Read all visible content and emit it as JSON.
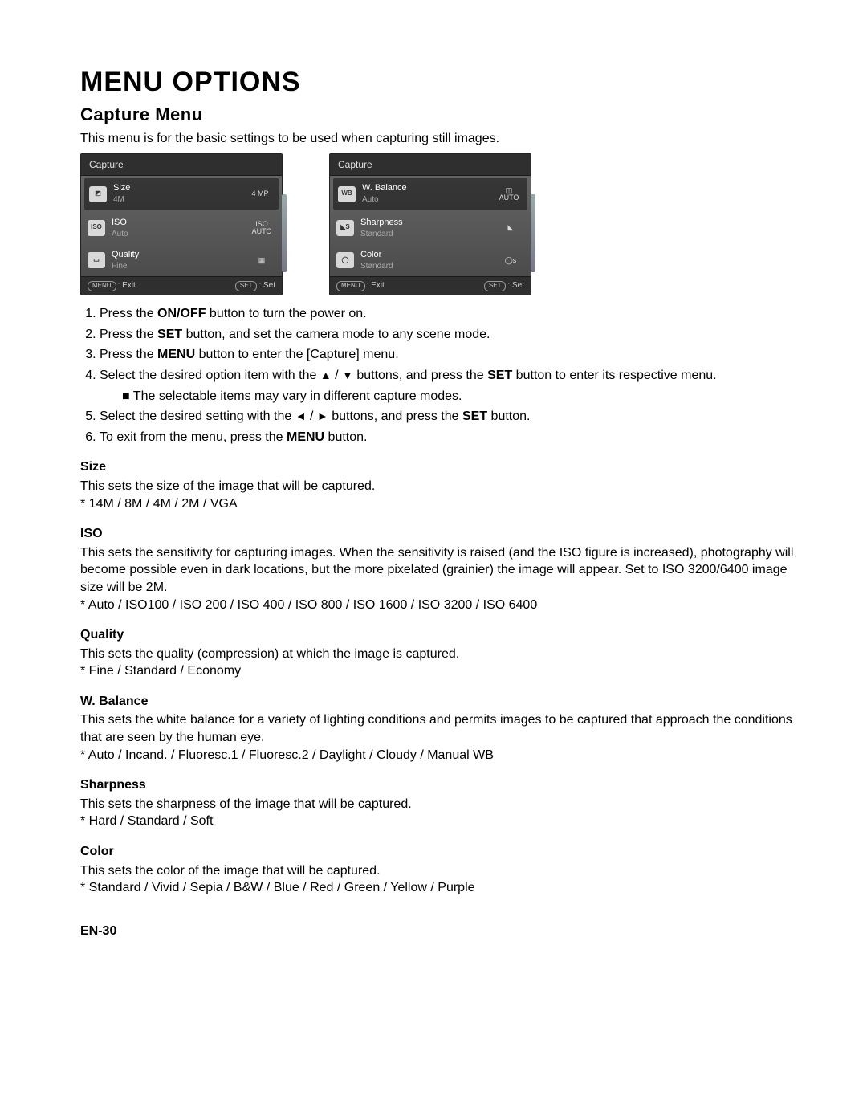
{
  "title": "MENU OPTIONS",
  "subtitle": "Capture Menu",
  "intro": "This menu is for the basic settings to be used when capturing still images.",
  "screens": {
    "left": {
      "header": "Capture",
      "rows": [
        {
          "icon": "◩",
          "name": "Size",
          "value": "4M",
          "right": "4\nMP",
          "highlight": true
        },
        {
          "icon": "ISO",
          "name": "ISO",
          "value": "Auto",
          "right": "ISO\nAUTO",
          "highlight": false
        },
        {
          "icon": "▭",
          "name": "Quality",
          "value": "Fine",
          "right": "▦",
          "highlight": false
        }
      ],
      "footer": {
        "menu_btn": "MENU",
        "menu_lbl": ": Exit",
        "set_btn": "SET",
        "set_lbl": ": Set"
      }
    },
    "right": {
      "header": "Capture",
      "rows": [
        {
          "icon": "WB",
          "name": "W. Balance",
          "value": "Auto",
          "right": "◫\nAUTO",
          "highlight": true
        },
        {
          "icon": "◣S",
          "name": "Sharpness",
          "value": "Standard",
          "right": "◣",
          "highlight": false
        },
        {
          "icon": "◯",
          "name": "Color",
          "value": "Standard",
          "right": "◯s",
          "highlight": false
        }
      ],
      "footer": {
        "menu_btn": "MENU",
        "menu_lbl": ": Exit",
        "set_btn": "SET",
        "set_lbl": ": Set"
      }
    }
  },
  "steps": {
    "s1a": "Press the ",
    "s1b": "ON/OFF",
    "s1c": " button to turn the power on.",
    "s2a": "Press the ",
    "s2b": "SET",
    "s2c": " button, and set the camera mode to any scene mode.",
    "s3a": "Press the ",
    "s3b": "MENU",
    "s3c": " button to enter the [Capture] menu.",
    "s4a": "Select the desired option item with the ",
    "s4b": "▲",
    "s4c": " / ",
    "s4d": "▼",
    "s4e": " buttons, and press the ",
    "s4f": "SET",
    "s4g": " button to enter its respective menu.",
    "s4_sub": "The selectable items may vary in different capture modes.",
    "s5a": "Select the desired setting with the ",
    "s5b": "◄",
    "s5c": " / ",
    "s5d": "►",
    "s5e": " buttons, and press the ",
    "s5f": "SET",
    "s5g": " button.",
    "s6a": "To exit from the menu, press the ",
    "s6b": "MENU",
    "s6c": " button."
  },
  "sections": [
    {
      "heading": "Size",
      "desc": "This sets the size of the image that will be captured.",
      "opts": "* 14M / 8M / 4M / 2M / VGA"
    },
    {
      "heading": "ISO",
      "desc": "This sets the sensitivity for capturing images. When the sensitivity is raised (and the ISO figure is increased), photography will become possible even in dark locations, but the more pixelated (grainier) the image will appear. Set to ISO 3200/6400 image size will be 2M.",
      "opts": "* Auto / ISO100 / ISO 200 / ISO 400 / ISO 800 / ISO 1600 / ISO 3200  / ISO 6400"
    },
    {
      "heading": "Quality",
      "desc": "This sets the quality (compression) at which the image is captured.",
      "opts": "* Fine / Standard / Economy"
    },
    {
      "heading": "W. Balance",
      "desc": "This sets the white balance for a variety of lighting conditions and permits images to be captured that approach the conditions that are seen by the human eye.",
      "opts": "* Auto / Incand. / Fluoresc.1 / Fluoresc.2 / Daylight / Cloudy / Manual WB"
    },
    {
      "heading": "Sharpness",
      "desc": "This sets the sharpness of the image that will be captured.",
      "opts": "* Hard / Standard / Soft"
    },
    {
      "heading": "Color",
      "desc": "This sets the color of the image that will be captured.",
      "opts": "* Standard / Vivid / Sepia / B&W / Blue / Red / Green / Yellow / Purple"
    }
  ],
  "page_number": "EN-30"
}
